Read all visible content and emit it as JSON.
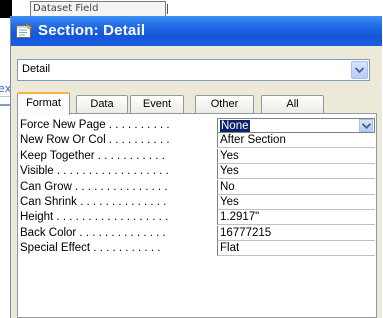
{
  "background": {
    "field_text": "Dataset Field",
    "link_text_1": "ex",
    "link_text_2": ""
  },
  "window": {
    "title": "Section: Detail"
  },
  "selector": {
    "value": "Detail"
  },
  "tabs": [
    {
      "label": "Format",
      "active": true
    },
    {
      "label": "Data",
      "active": false
    },
    {
      "label": "Event",
      "active": false
    },
    {
      "label": "Other",
      "active": false
    },
    {
      "label": "All",
      "active": false
    }
  ],
  "properties": [
    {
      "name": "Force New Page . . . . . . . . . .",
      "value": "None"
    },
    {
      "name": "New Row Or Col . . . . . . . . . .",
      "value": "After Section"
    },
    {
      "name": "Keep Together . . . . . . . . . . .",
      "value": "Yes"
    },
    {
      "name": "Visible . . . . . . . . . . . . . . . . . .",
      "value": "Yes"
    },
    {
      "name": "Can Grow . . . . . . . . . . . . . . .",
      "value": "No"
    },
    {
      "name": "Can Shrink . . . . . . . . . . . . . .",
      "value": "Yes"
    },
    {
      "name": "Height . . . . . . . . . . . . . . . . . .",
      "value": "1.2917\""
    },
    {
      "name": "Back Color . . . . . . . . . . . . . .",
      "value": "16777215"
    },
    {
      "name": "Special Effect . . . . . . . . . . .",
      "value": "Flat"
    }
  ],
  "colors": {
    "titlebar": "#1c64e2",
    "tab_highlight": "#f9b43a",
    "selection": "#0a246a"
  }
}
